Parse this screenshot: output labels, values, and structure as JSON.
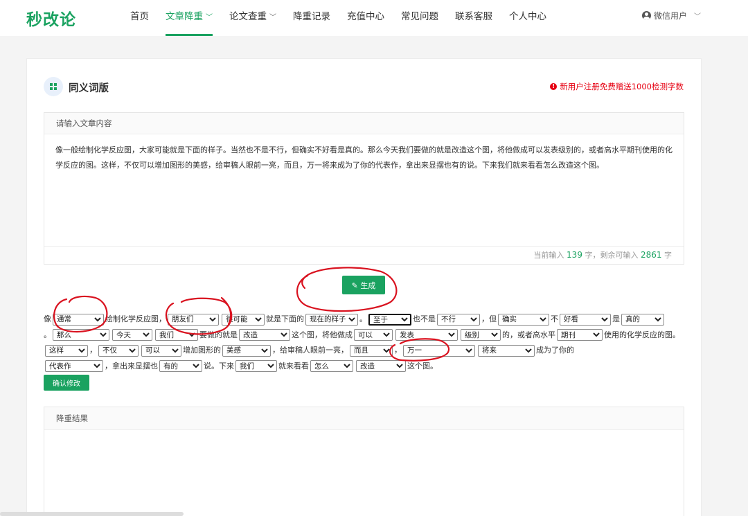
{
  "nav": {
    "logo": "秒改论",
    "links": [
      "首页",
      "文章降重",
      "论文查重",
      "降重记录",
      "充值中心",
      "常见问题",
      "联系客服",
      "个人中心"
    ],
    "user": "微信用户"
  },
  "card": {
    "title": "同义词版",
    "promo": "新用户注册免费赠送1000检测字数",
    "input_header": "请输入文章内容",
    "input_text": "像一般绘制化学反应图，大家可能就是下面的样子。当然也不是不行，但确实不好看是真的。那么今天我们要做的就是改造这个图，将他做成可以发表级别的，或者高水平期刊使用的化学反应的图。这样，不仅可以增加图形的美感，给审稿人眼前一亮，而且，万一将来成为了你的代表作，拿出来显摆也有的说。下来我们就来看看怎么改造这个图。",
    "count_prefix": "当前输入",
    "count_input": "139",
    "count_mid": "字，剩余可输入",
    "count_remain": "2861",
    "count_suffix": "字",
    "generate": "生成",
    "confirm": "确认修改",
    "result_header": "降重结果"
  },
  "sentence": {
    "t0": "像",
    "s0": "通常",
    "t1": "绘制化学反应图，",
    "s1": "朋友们",
    "s2": "很可能",
    "t2": "就是下面的",
    "s3": "现在的样子",
    "t3": "。",
    "s4": "至于",
    "t4": "也不是",
    "s5": "不行",
    "t5": "，但",
    "s6": "确实",
    "t6": "不",
    "s7": "好看",
    "t7": "是",
    "s8": "真的",
    "t8": "。",
    "s9": "那么",
    "s10": "今天",
    "s11": "我们",
    "t9": "要做的就是",
    "s12": "改造",
    "t10": "这个图，将他做成",
    "s13": "可以",
    "s14": "发表",
    "s15": "级别",
    "t11": "的，或者高水平",
    "s16": "期刊",
    "t12": "使用的化学反应的图。",
    "s17": "这样",
    "t13": "，",
    "s18": "不仅",
    "s19": "可以",
    "t14": "增加图形的",
    "s20": "美感",
    "t15": "，给审稿人眼前一亮，",
    "s21": "而且",
    "t16": "，",
    "s22": "万一",
    "s23": "将来",
    "t17": "成为了你的",
    "s24": "代表作",
    "t18": "，拿出来显摆也",
    "s25": "有的",
    "t19": "说。下来",
    "s26": "我们",
    "t20": "就来看看",
    "s27": "怎么",
    "s28": "改造",
    "t21": "这个图。"
  },
  "colors": {
    "accent": "#1aa260",
    "promo": "#e60012",
    "annotation": "#d9121f"
  },
  "icons": {
    "card": "grid-icon",
    "promo": "alert-circle-icon",
    "user": "user-circle-icon",
    "generate": "pencil-icon"
  }
}
